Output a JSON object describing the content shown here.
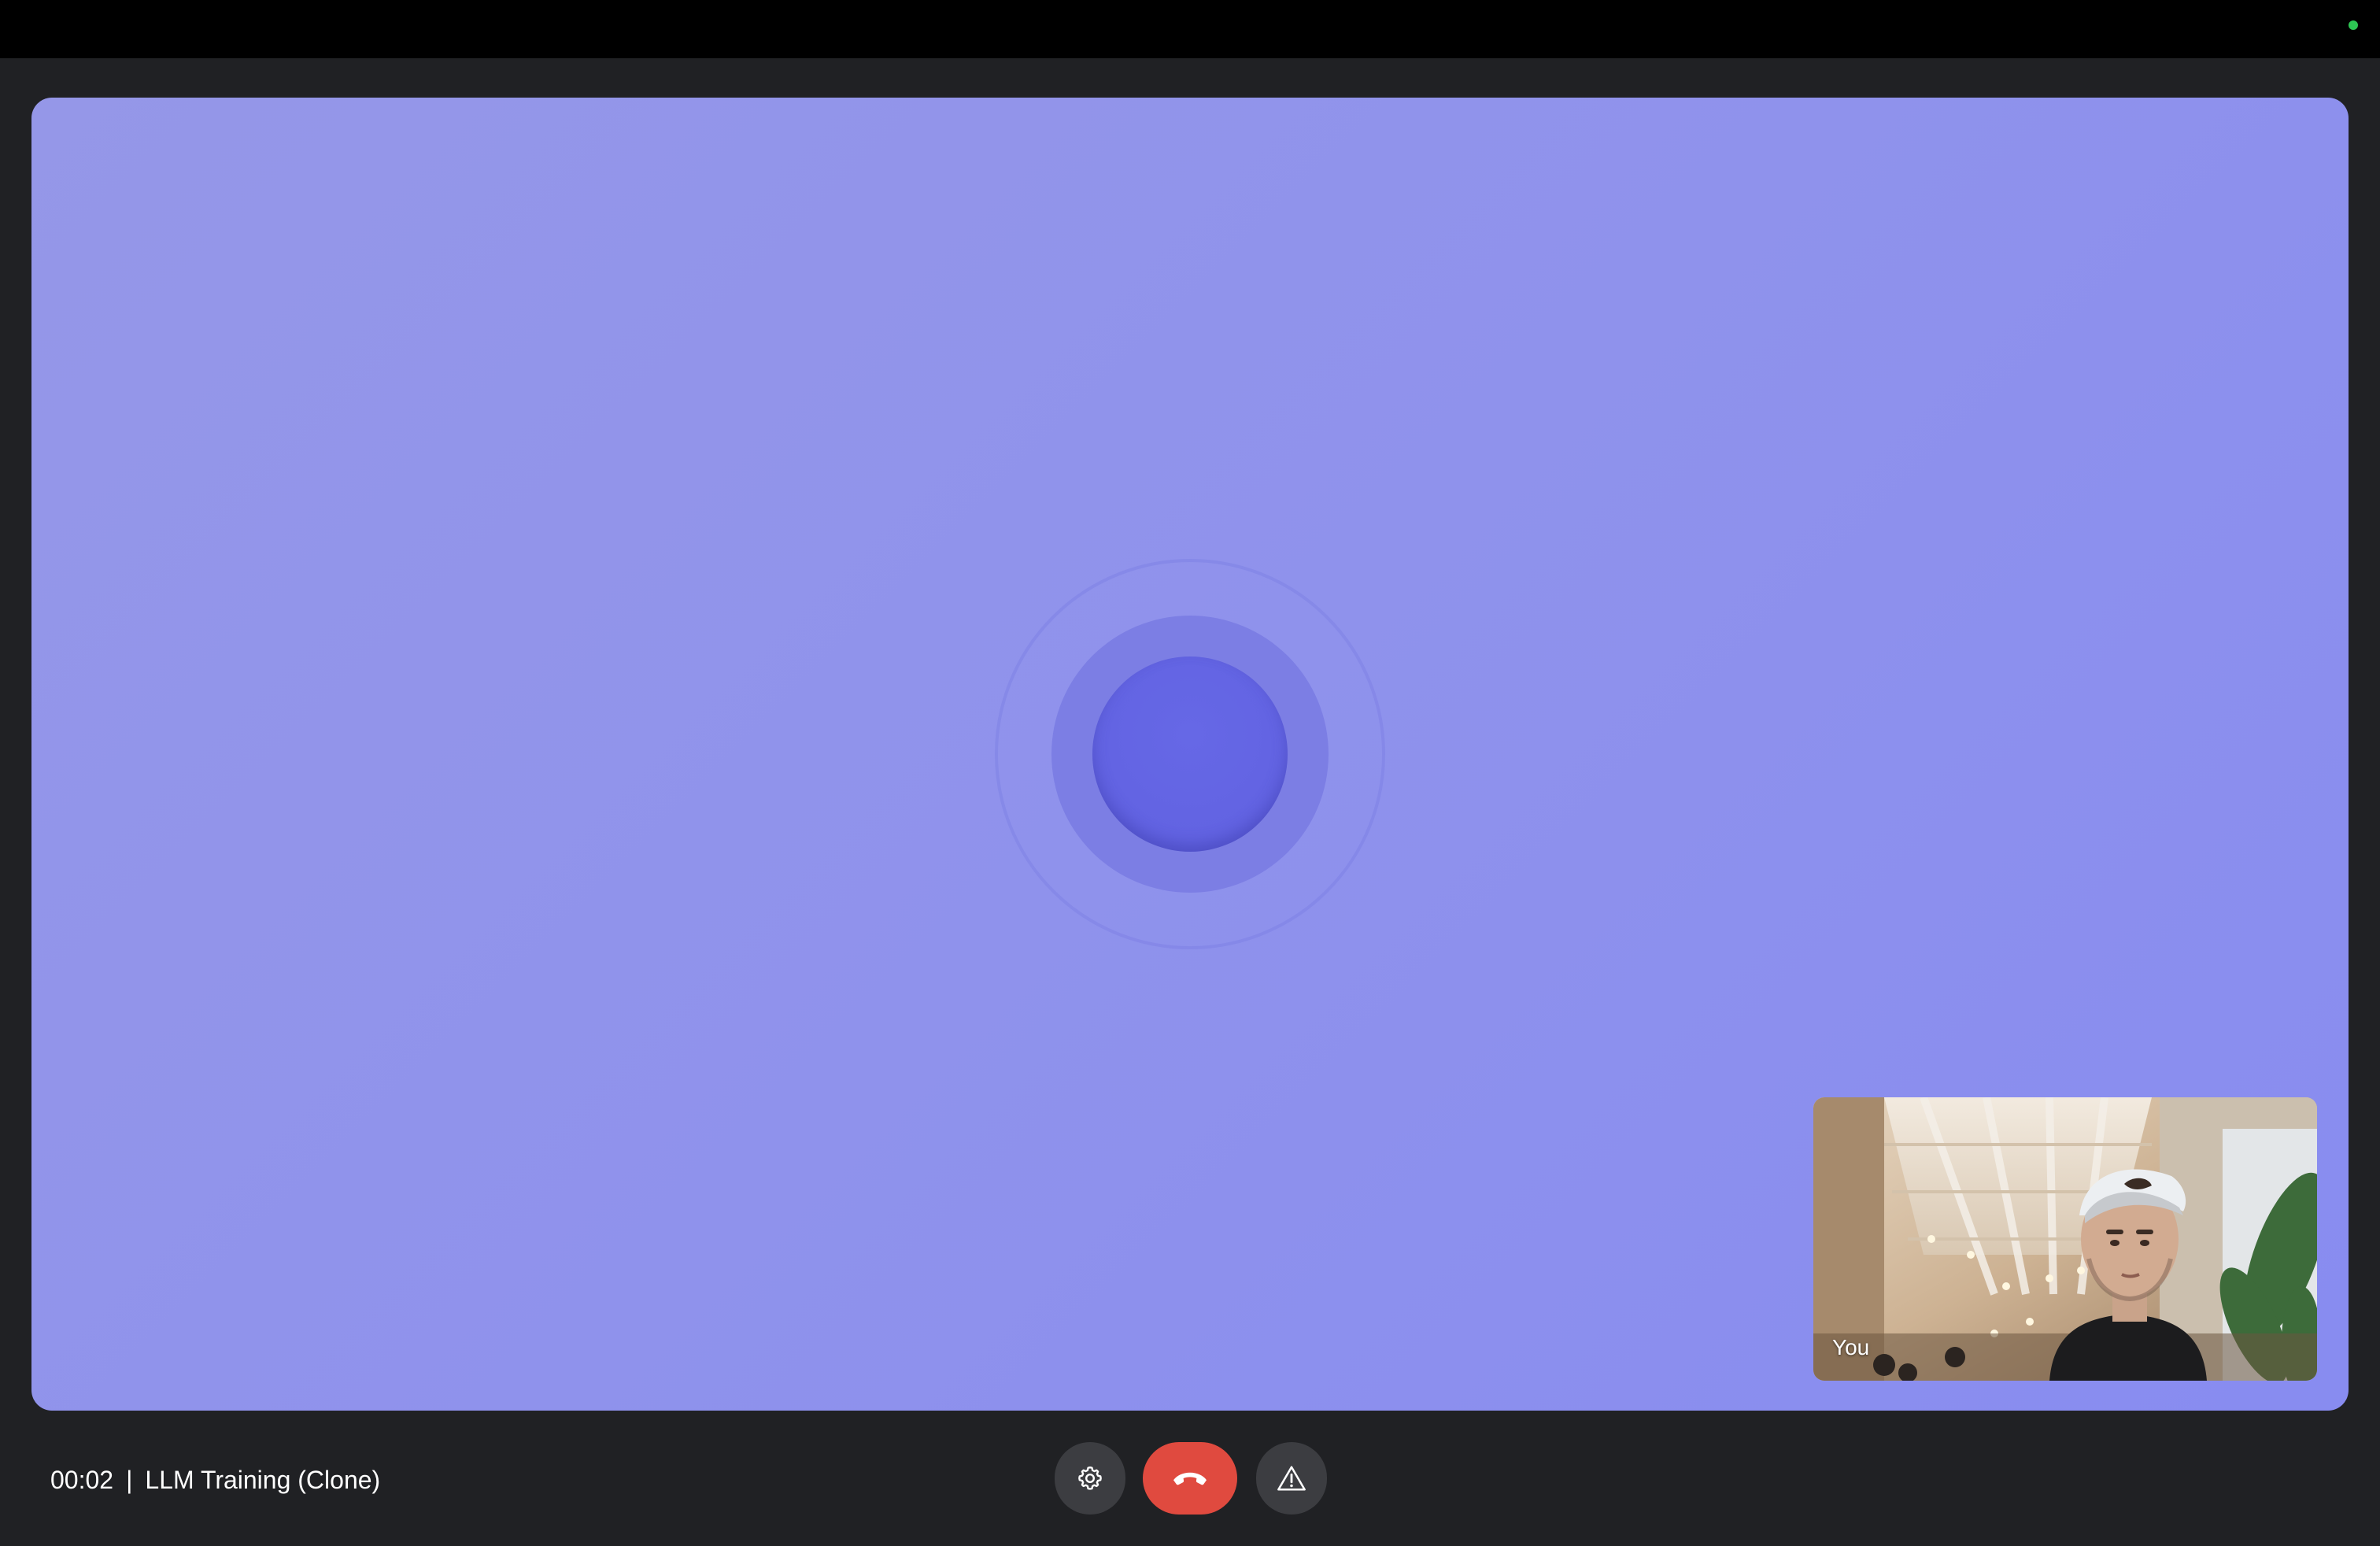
{
  "window": {
    "status_indicator_color": "#2dc653"
  },
  "stage": {
    "background_color": "#8f92ec",
    "orb_color": "#6263e2"
  },
  "self_view": {
    "label": "You"
  },
  "call_info": {
    "elapsed": "00:02",
    "separator": "|",
    "title": "LLM Training (Clone)"
  },
  "controls": {
    "settings_icon": "gear-icon",
    "hangup_icon": "phone-hangup-icon",
    "hangup_color": "#e04a3f",
    "report_icon": "warning-triangle-icon"
  }
}
